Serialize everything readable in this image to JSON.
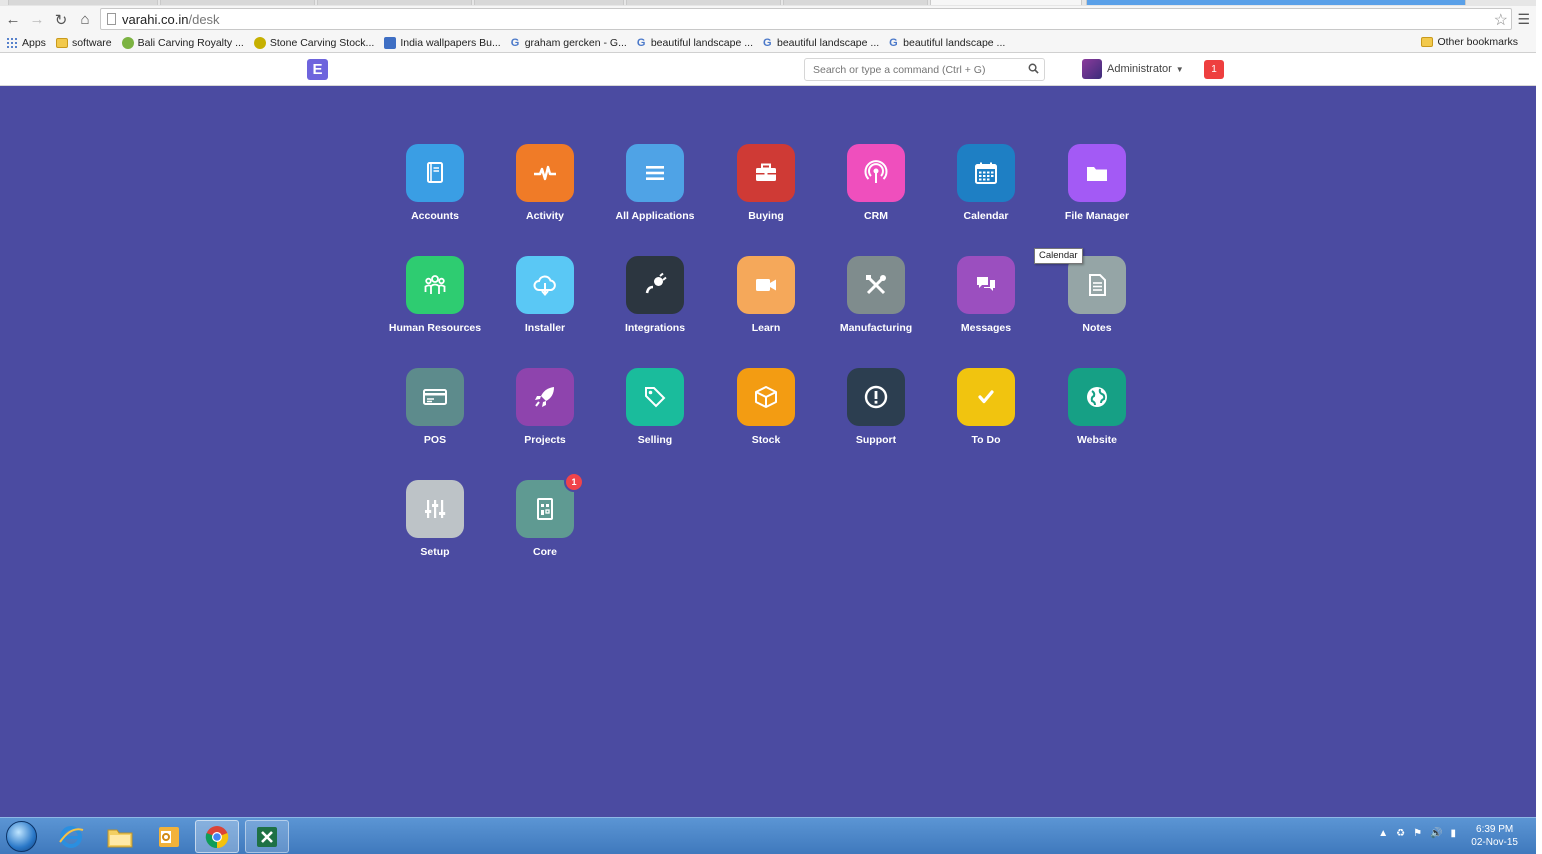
{
  "browser": {
    "url_host": "varahi.co.in",
    "url_path": "/desk",
    "bookmarks": [
      {
        "label": "Apps",
        "icon": "apps-grid-icon"
      },
      {
        "label": "software",
        "icon": "folder-icon"
      },
      {
        "label": "Bali Carving Royalty ...",
        "icon": "site-icon"
      },
      {
        "label": "Stone Carving Stock...",
        "icon": "site-icon"
      },
      {
        "label": "India wallpapers Bu...",
        "icon": "site-icon"
      },
      {
        "label": "graham gercken - G...",
        "icon": "google-icon"
      },
      {
        "label": "beautiful landscape ...",
        "icon": "google-icon"
      },
      {
        "label": "beautiful landscape ...",
        "icon": "google-icon"
      },
      {
        "label": "beautiful landscape ...",
        "icon": "google-icon"
      }
    ],
    "other_bookmarks": "Other bookmarks"
  },
  "header": {
    "logo_letter": "E",
    "search_placeholder": "Search or type a command (Ctrl + G)",
    "user_name": "Administrator",
    "notification_count": "1"
  },
  "tooltip": "Calendar",
  "apps": [
    {
      "label": "Accounts",
      "color": "#3a9ee4",
      "icon": "book-icon"
    },
    {
      "label": "Activity",
      "color": "#f07b27",
      "icon": "pulse-icon"
    },
    {
      "label": "All Applications",
      "color": "#4fa3e6",
      "icon": "list-icon"
    },
    {
      "label": "Buying",
      "color": "#cf3a35",
      "icon": "briefcase-icon"
    },
    {
      "label": "CRM",
      "color": "#ef4fbd",
      "icon": "broadcast-icon"
    },
    {
      "label": "Calendar",
      "color": "#1e7fc4",
      "icon": "calendar-icon"
    },
    {
      "label": "File Manager",
      "color": "#a35af5",
      "icon": "folder-icon"
    },
    {
      "label": "Human Resources",
      "color": "#2ecc71",
      "icon": "people-icon"
    },
    {
      "label": "Installer",
      "color": "#5ac8f5",
      "icon": "cloud-download-icon"
    },
    {
      "label": "Integrations",
      "color": "#2c3640",
      "icon": "plug-icon"
    },
    {
      "label": "Learn",
      "color": "#f5a85a",
      "icon": "video-icon"
    },
    {
      "label": "Manufacturing",
      "color": "#7f8c8d",
      "icon": "tools-icon"
    },
    {
      "label": "Messages",
      "color": "#9b4fbf",
      "icon": "chat-icon"
    },
    {
      "label": "Notes",
      "color": "#95a5a6",
      "icon": "document-icon"
    },
    {
      "label": "POS",
      "color": "#5d8b8c",
      "icon": "card-icon"
    },
    {
      "label": "Projects",
      "color": "#8e44ad",
      "icon": "rocket-icon"
    },
    {
      "label": "Selling",
      "color": "#1abc9c",
      "icon": "tag-icon"
    },
    {
      "label": "Stock",
      "color": "#f39c12",
      "icon": "box-icon"
    },
    {
      "label": "Support",
      "color": "#2c3e50",
      "icon": "alert-icon"
    },
    {
      "label": "To Do",
      "color": "#f1c40f",
      "icon": "check-icon"
    },
    {
      "label": "Website",
      "color": "#16a085",
      "icon": "globe-icon"
    },
    {
      "label": "Setup",
      "color": "#bdc3c7",
      "icon": "sliders-icon"
    },
    {
      "label": "Core",
      "color": "#5f9a92",
      "icon": "doc-grid-icon",
      "badge": "1"
    }
  ],
  "taskbar": {
    "apps": [
      "internet-explorer-icon",
      "file-explorer-icon",
      "outlook-icon",
      "chrome-icon",
      "excel-icon"
    ],
    "time": "6:39 PM",
    "date": "02-Nov-15"
  }
}
